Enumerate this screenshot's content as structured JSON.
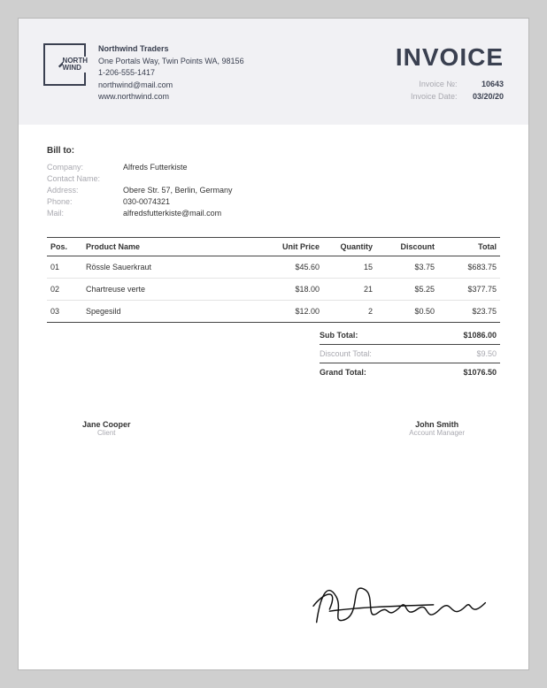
{
  "header": {
    "logo_line1": "NORTH",
    "logo_line2": "WIND",
    "company_name": "Northwind Traders",
    "address": "One Portals Way, Twin Points WA, 98156",
    "phone": "1-206-555-1417",
    "email": "northwind@mail.com",
    "website": "www.northwind.com",
    "invoice_title": "INVOICE",
    "invoice_no_label": "Invoice №:",
    "invoice_no_value": "10643",
    "invoice_date_label": "Invoice Date:",
    "invoice_date_value": "03/20/20"
  },
  "billto": {
    "title": "Bill to:",
    "company_label": "Company:",
    "company": "Alfreds Futterkiste",
    "contact_label": "Contact Name:",
    "contact": "",
    "address_label": "Address:",
    "address": "Obere Str. 57, Berlin, Germany",
    "phone_label": "Phone:",
    "phone": "030-0074321",
    "mail_label": "Mail:",
    "mail": "alfredsfutterkiste@mail.com"
  },
  "table": {
    "headers": {
      "pos": "Pos.",
      "name": "Product Name",
      "price": "Unit Price",
      "qty": "Quantity",
      "disc": "Discount",
      "total": "Total"
    },
    "rows": [
      {
        "pos": "01",
        "name": "Rössle Sauerkraut",
        "price": "$45.60",
        "qty": "15",
        "disc": "$3.75",
        "total": "$683.75"
      },
      {
        "pos": "02",
        "name": "Chartreuse verte",
        "price": "$18.00",
        "qty": "21",
        "disc": "$5.25",
        "total": "$377.75"
      },
      {
        "pos": "03",
        "name": "Spegesild",
        "price": "$12.00",
        "qty": "2",
        "disc": "$0.50",
        "total": "$23.75"
      }
    ]
  },
  "totals": {
    "sub_label": "Sub Total:",
    "sub_value": "$1086.00",
    "disc_label": "Discount Total:",
    "disc_value": "$9.50",
    "grand_label": "Grand Total:",
    "grand_value": "$1076.50"
  },
  "signatures": {
    "left_name": "Jane Cooper",
    "left_role": "Client",
    "right_name": "John Smith",
    "right_role": "Account Manager"
  }
}
